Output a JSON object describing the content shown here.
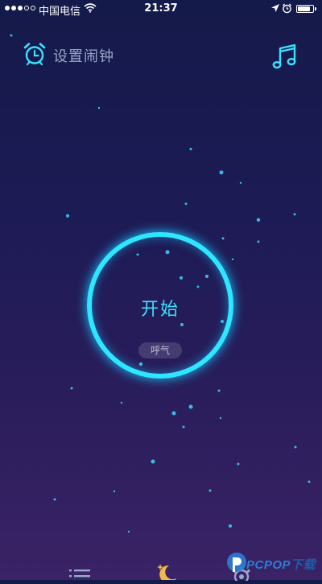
{
  "status_bar": {
    "carrier": "中国电信",
    "time": "21:37",
    "battery_level": 0.85
  },
  "header": {
    "alarm_label": "设置闹钟",
    "alarm_icon": "alarm-clock-icon",
    "music_icon": "music-note-icon"
  },
  "main": {
    "start_label": "开始",
    "mode_badge": "呼气"
  },
  "bottom_bar": {
    "icons": [
      "list-icon",
      "moon-stars-icon",
      "gear-icon"
    ]
  },
  "watermark": {
    "brand": "PCPOP",
    "suffix": "下载"
  },
  "colors": {
    "accent": "#2ee6ff",
    "bg_top": "#141a4a",
    "bg_bottom": "#3a2366",
    "moon": "#f2b84b"
  }
}
